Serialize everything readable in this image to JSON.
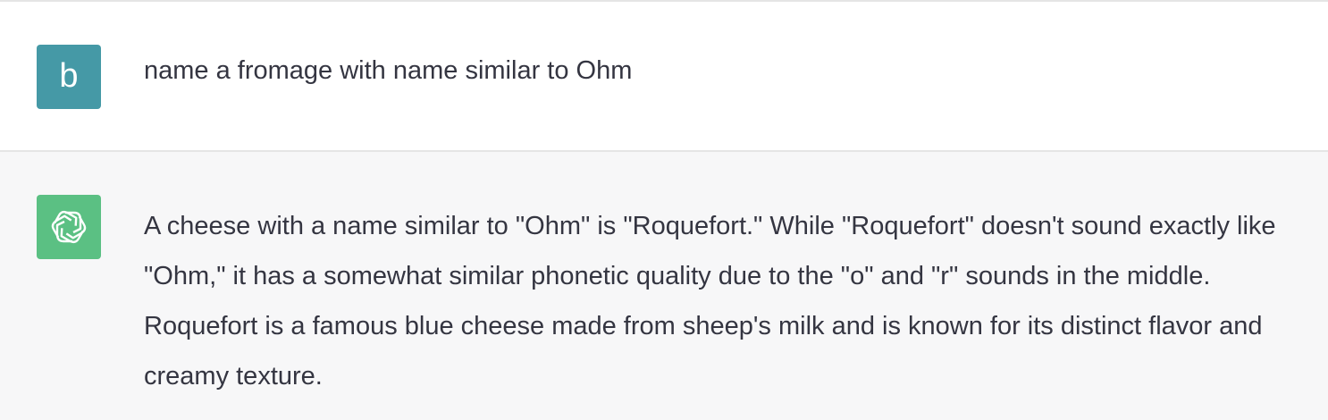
{
  "conversation": {
    "user_message": {
      "avatar_letter": "b",
      "avatar_color": "#4599a6",
      "text": "name a fromage with name similar to Ohm"
    },
    "assistant_message": {
      "avatar_icon": "openai-logo-icon",
      "avatar_color": "#5bc083",
      "text": "A cheese with a name similar to \"Ohm\" is \"Roquefort.\" While \"Roquefort\" doesn't sound exactly like \"Ohm,\" it has a somewhat similar phonetic quality due to the \"o\" and \"r\" sounds in the middle. Roquefort is a famous blue cheese made from sheep's milk and is known for its distinct flavor and creamy texture."
    }
  }
}
